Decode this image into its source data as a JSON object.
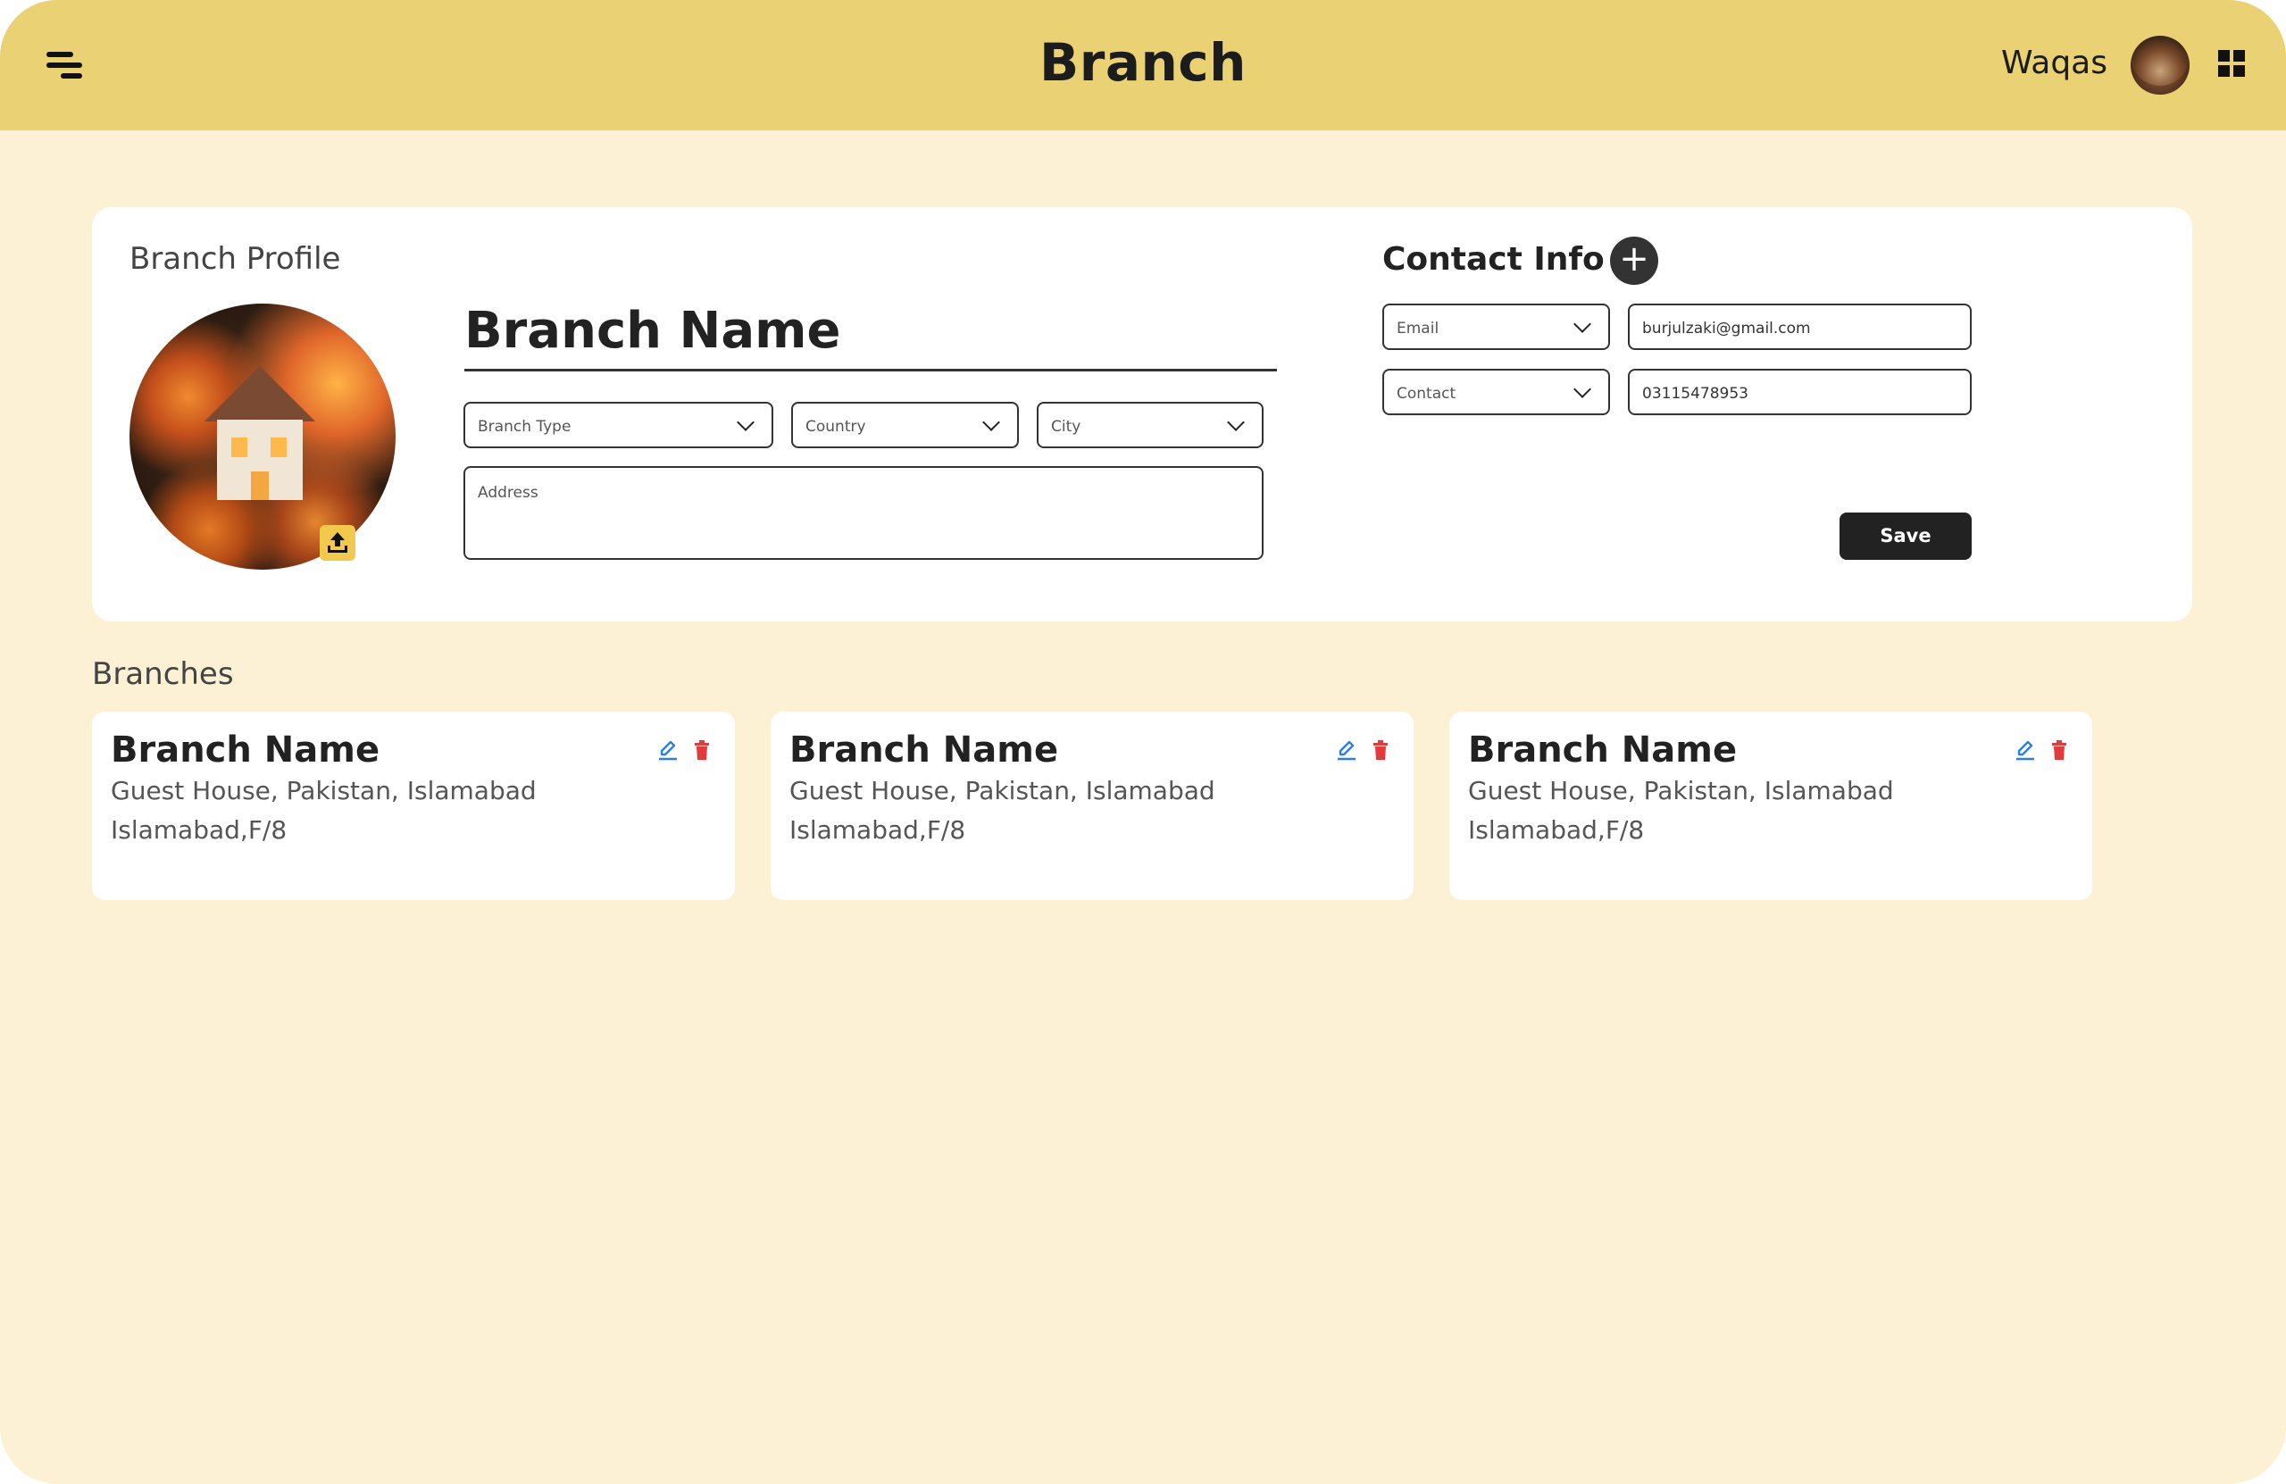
{
  "header": {
    "title": "Branch",
    "user_name": "Waqas",
    "menu_icon": "menu-icon",
    "apps_icon": "grid-icon"
  },
  "profile": {
    "section_label": "Branch Profile",
    "branch_name": "Branch Name",
    "branch_type_placeholder": "Branch Type",
    "country_placeholder": "Country",
    "city_placeholder": "City",
    "address_placeholder": "Address",
    "upload_icon": "upload-icon"
  },
  "contact": {
    "title": "Contact Info",
    "add_label": "+",
    "rows": [
      {
        "type": "Email",
        "value": "burjulzaki@gmail.com"
      },
      {
        "type": "Contact",
        "value": "03115478953"
      }
    ],
    "save_label": "Save"
  },
  "branches": {
    "title": "Branches",
    "items": [
      {
        "name": "Branch Name",
        "line1": "Guest House, Pakistan, Islamabad",
        "line2": "Islamabad,F/8"
      },
      {
        "name": "Branch Name",
        "line1": "Guest House, Pakistan, Islamabad",
        "line2": "Islamabad,F/8"
      },
      {
        "name": "Branch Name",
        "line1": "Guest House, Pakistan, Islamabad",
        "line2": "Islamabad,F/8"
      }
    ]
  },
  "colors": {
    "topbar": "#ead173",
    "background": "#fcf1d4",
    "edit_icon": "#2f7fe0",
    "delete_icon": "#e23b3b"
  }
}
